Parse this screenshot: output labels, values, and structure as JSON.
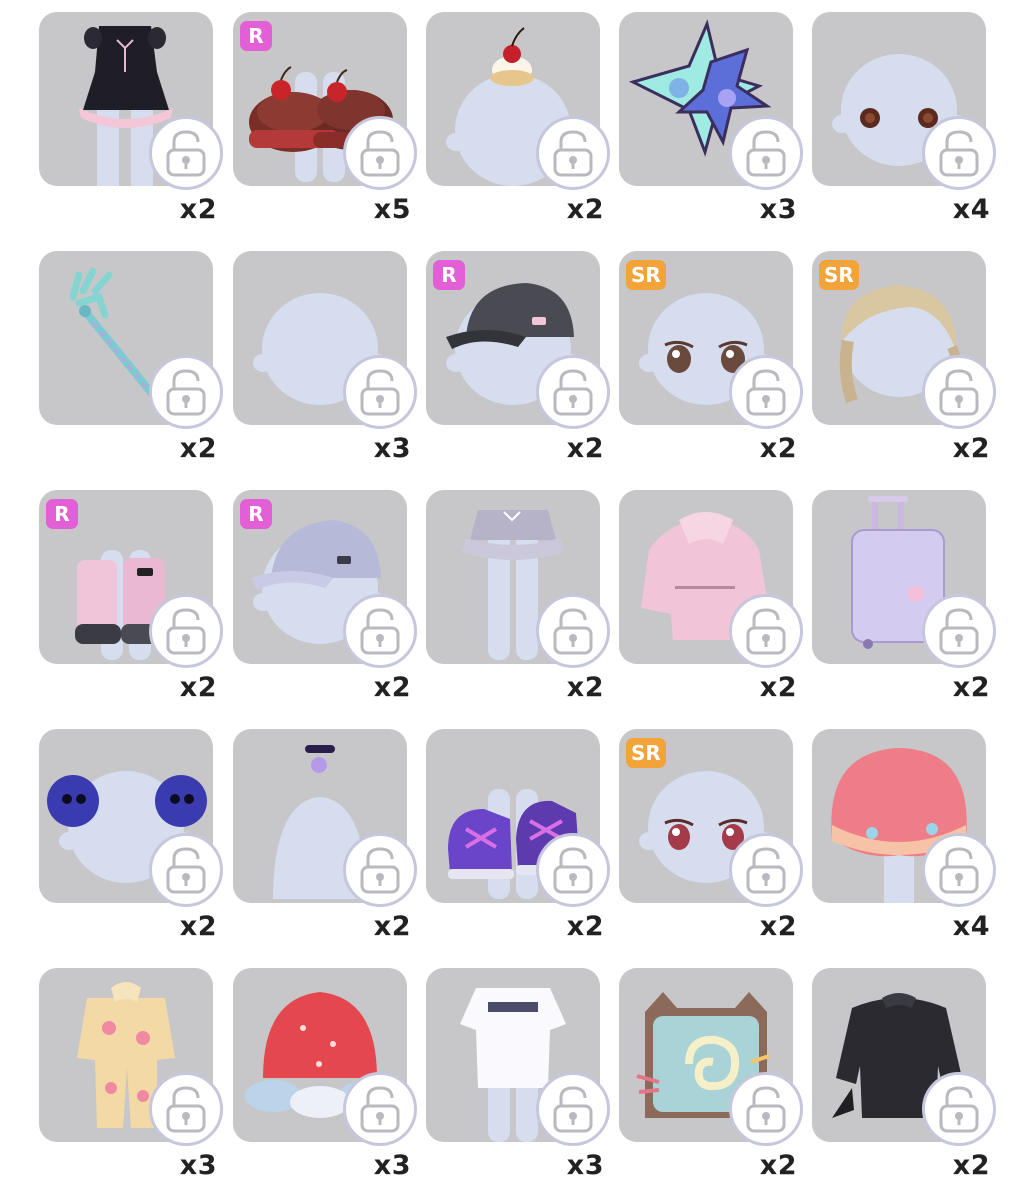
{
  "items": [
    {
      "icon": "black-dress-icon",
      "badge": "",
      "count": "x2"
    },
    {
      "icon": "cherry-cake-shoes-icon",
      "badge": "R",
      "count": "x5"
    },
    {
      "icon": "cherry-cream-hat-icon",
      "badge": "",
      "count": "x2"
    },
    {
      "icon": "star-cushions-icon",
      "badge": "",
      "count": "x3"
    },
    {
      "icon": "round-brown-eyes-icon",
      "badge": "",
      "count": "x4"
    },
    {
      "icon": "teal-trident-wand-icon",
      "badge": "",
      "count": "x2"
    },
    {
      "icon": "blank-head-icon",
      "badge": "",
      "count": "x3"
    },
    {
      "icon": "black-baseball-cap-icon",
      "badge": "R",
      "count": "x2"
    },
    {
      "icon": "brown-eyes-icon",
      "badge": "SR",
      "count": "x2"
    },
    {
      "icon": "blonde-braided-hair-icon",
      "badge": "SR",
      "count": "x2"
    },
    {
      "icon": "pink-leg-warmer-boots-icon",
      "badge": "R",
      "count": "x2"
    },
    {
      "icon": "lavender-baseball-cap-icon",
      "badge": "R",
      "count": "x2"
    },
    {
      "icon": "gray-ruffle-skirt-icon",
      "badge": "",
      "count": "x2"
    },
    {
      "icon": "pink-hoodie-icon",
      "badge": "",
      "count": "x2"
    },
    {
      "icon": "lavender-suitcase-icon",
      "badge": "",
      "count": "x2"
    },
    {
      "icon": "purple-skull-hair-buns-icon",
      "badge": "",
      "count": "x2"
    },
    {
      "icon": "purple-choker-necklace-icon",
      "badge": "",
      "count": "x2"
    },
    {
      "icon": "purple-sneakers-icon",
      "badge": "",
      "count": "x2"
    },
    {
      "icon": "pink-sparkle-eyes-icon",
      "badge": "SR",
      "count": "x2"
    },
    {
      "icon": "jelly-pudding-hat-icon",
      "badge": "",
      "count": "x4"
    },
    {
      "icon": "flower-pajamas-icon",
      "badge": "",
      "count": "x3"
    },
    {
      "icon": "strawberry-cloud-hat-icon",
      "badge": "",
      "count": "x3"
    },
    {
      "icon": "white-graphic-tee-icon",
      "badge": "",
      "count": "x3"
    },
    {
      "icon": "cat-swiss-roll-bag-icon",
      "badge": "",
      "count": "x2"
    },
    {
      "icon": "black-lace-top-icon",
      "badge": "",
      "count": "x2"
    }
  ]
}
